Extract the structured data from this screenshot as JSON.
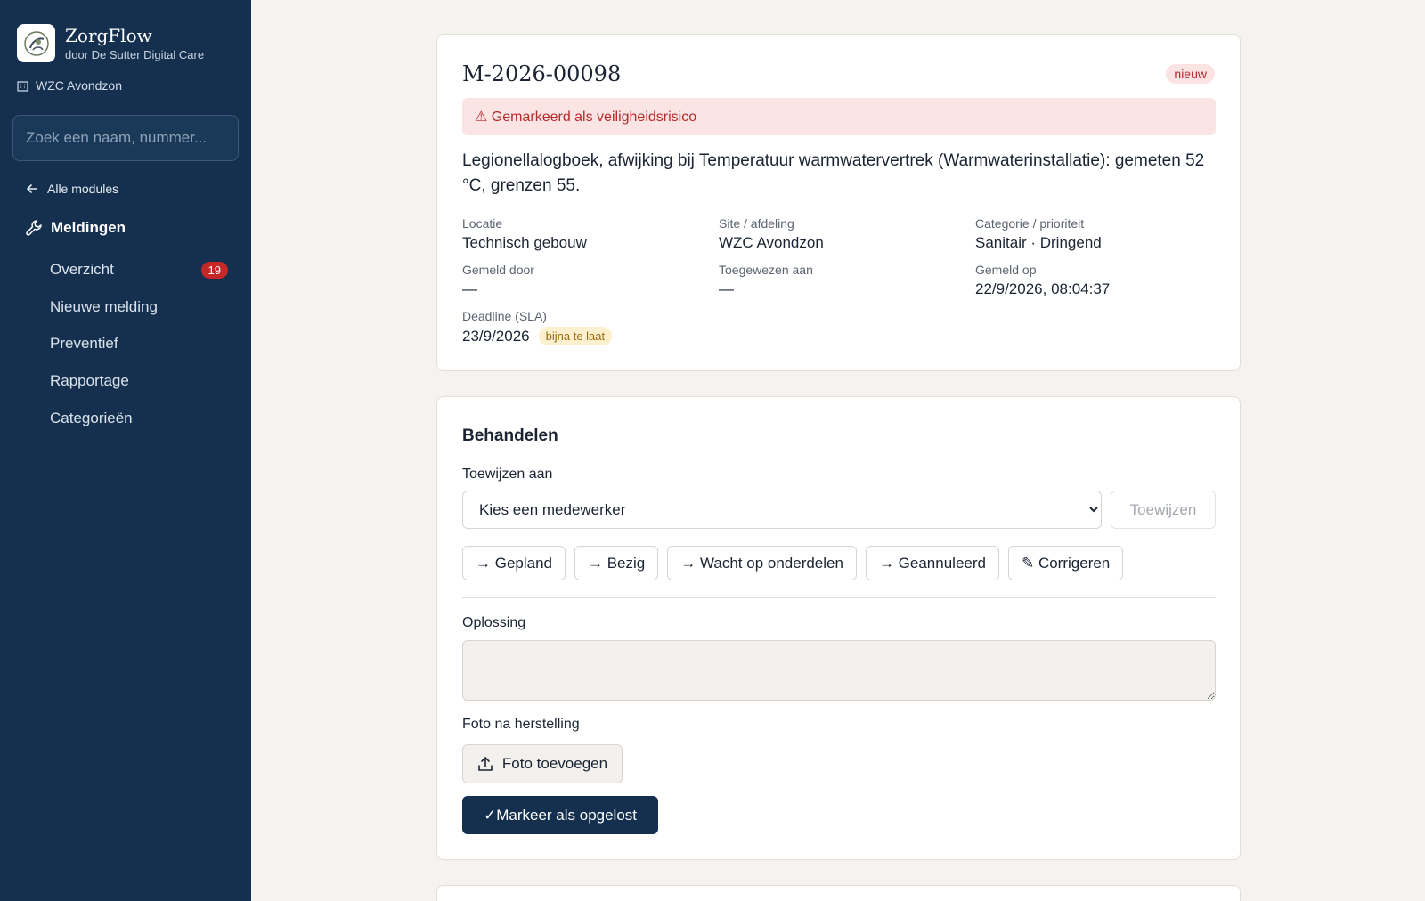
{
  "brand": {
    "name": "ZorgFlow",
    "subtitle": "door De Sutter Digital Care"
  },
  "site": {
    "name": "WZC Avondzon"
  },
  "search": {
    "placeholder": "Zoek een naam, nummer..."
  },
  "nav": {
    "back_label": "Alle modules",
    "module_title": "Meldingen",
    "items": [
      {
        "label": "Overzicht",
        "count": "19"
      },
      {
        "label": "Nieuwe melding"
      },
      {
        "label": "Preventief"
      },
      {
        "label": "Rapportage"
      },
      {
        "label": "Categorieën"
      }
    ]
  },
  "ticket": {
    "id": "M-2026-00098",
    "status": "nieuw",
    "alert": "⚠ Gemarkeerd als veiligheidsrisico",
    "description": "Legionellalogboek, afwijking bij Temperatuur warmwatervertrek (Warmwaterinstallatie): gemeten 52 °C, grenzen 55.",
    "fields": {
      "locatie": {
        "label": "Locatie",
        "value": "Technisch gebouw"
      },
      "site": {
        "label": "Site / afdeling",
        "value": "WZC Avondzon"
      },
      "categorie": {
        "label": "Categorie / prioriteit",
        "value": "Sanitair · Dringend"
      },
      "gemeld_door": {
        "label": "Gemeld door",
        "value": "—"
      },
      "toegewezen": {
        "label": "Toegewezen aan",
        "value": "—"
      },
      "gemeld_op": {
        "label": "Gemeld op",
        "value": "22/9/2026, 08:04:37"
      },
      "deadline": {
        "label": "Deadline (SLA)",
        "value": "23/9/2026",
        "badge": "bijna te laat"
      }
    }
  },
  "handle": {
    "title": "Behandelen",
    "assign_label": "Toewijzen aan",
    "assign_selected": "Kies een medewerker",
    "assign_button": "Toewijzen",
    "status_buttons": [
      "→ Gepland",
      "→ Bezig",
      "→ Wacht op onderdelen",
      "→ Geannuleerd",
      "✎ Corrigeren"
    ],
    "solution_label": "Oplossing",
    "photo_label": "Foto na herstelling",
    "photo_button": "Foto toevoegen",
    "resolve_button": "✓Markeer als opgelost"
  },
  "colors": {
    "sidebar_bg": "#15304f",
    "page_bg": "#f5f3ef",
    "danger": "#b42b2b",
    "warning": "#9a6a0c",
    "primary": "#15304f"
  },
  "icons": [
    "app-logo-icon",
    "building-icon",
    "arrow-left-icon",
    "wrench-icon",
    "upload-icon"
  ]
}
